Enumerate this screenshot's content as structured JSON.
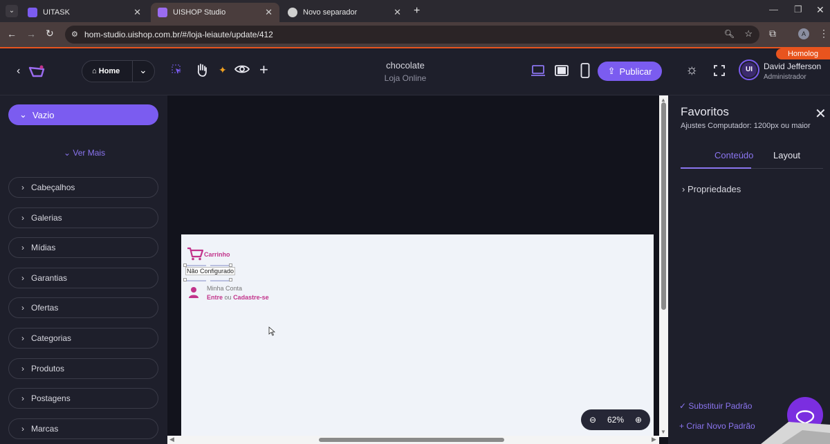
{
  "browser": {
    "tabs": [
      {
        "label": "UITASK"
      },
      {
        "label": "UISHOP Studio"
      },
      {
        "label": "Novo separador"
      }
    ],
    "url": "hom-studio.uishop.com.br/#/loja-leiaute/update/412",
    "profile_initial": "A"
  },
  "header": {
    "env_badge": "Homolog",
    "home_label": "Home",
    "store_title": "chocolate",
    "store_subtitle": "Loja Online",
    "publish_label": "Publicar",
    "user_name": "David Jefferson",
    "user_role": "Administrador",
    "avatar_text": "UI"
  },
  "sidebar": {
    "active_group": "Vazio",
    "more_label": "Ver Mais",
    "items": [
      {
        "label": "Cabeçalhos"
      },
      {
        "label": "Galerias"
      },
      {
        "label": "Mídias"
      },
      {
        "label": "Garantias"
      },
      {
        "label": "Ofertas"
      },
      {
        "label": "Categorias"
      },
      {
        "label": "Produtos"
      },
      {
        "label": "Postagens"
      },
      {
        "label": "Marcas"
      }
    ]
  },
  "canvas": {
    "cart_label": "Carrinho",
    "not_configured": "Não Configurado",
    "account_label": "Minha Conta",
    "login_link": "Entre",
    "or_text": "ou",
    "signup_link": "Cadastre-se",
    "zoom_level": "62%"
  },
  "panel": {
    "title": "Favoritos",
    "subtitle": "Ajustes Computador: 1200px ou maior",
    "tabs": [
      {
        "label": "Conteúdo",
        "active": true
      },
      {
        "label": "Layout",
        "active": false
      }
    ],
    "section_label": "Propriedades",
    "replace_default": "Substituir Padrão",
    "create_default": "Criar Novo Padrão"
  },
  "colors": {
    "accent": "#7b5cf0",
    "brand_pink": "#c2338b",
    "homolog": "#e8541e"
  }
}
